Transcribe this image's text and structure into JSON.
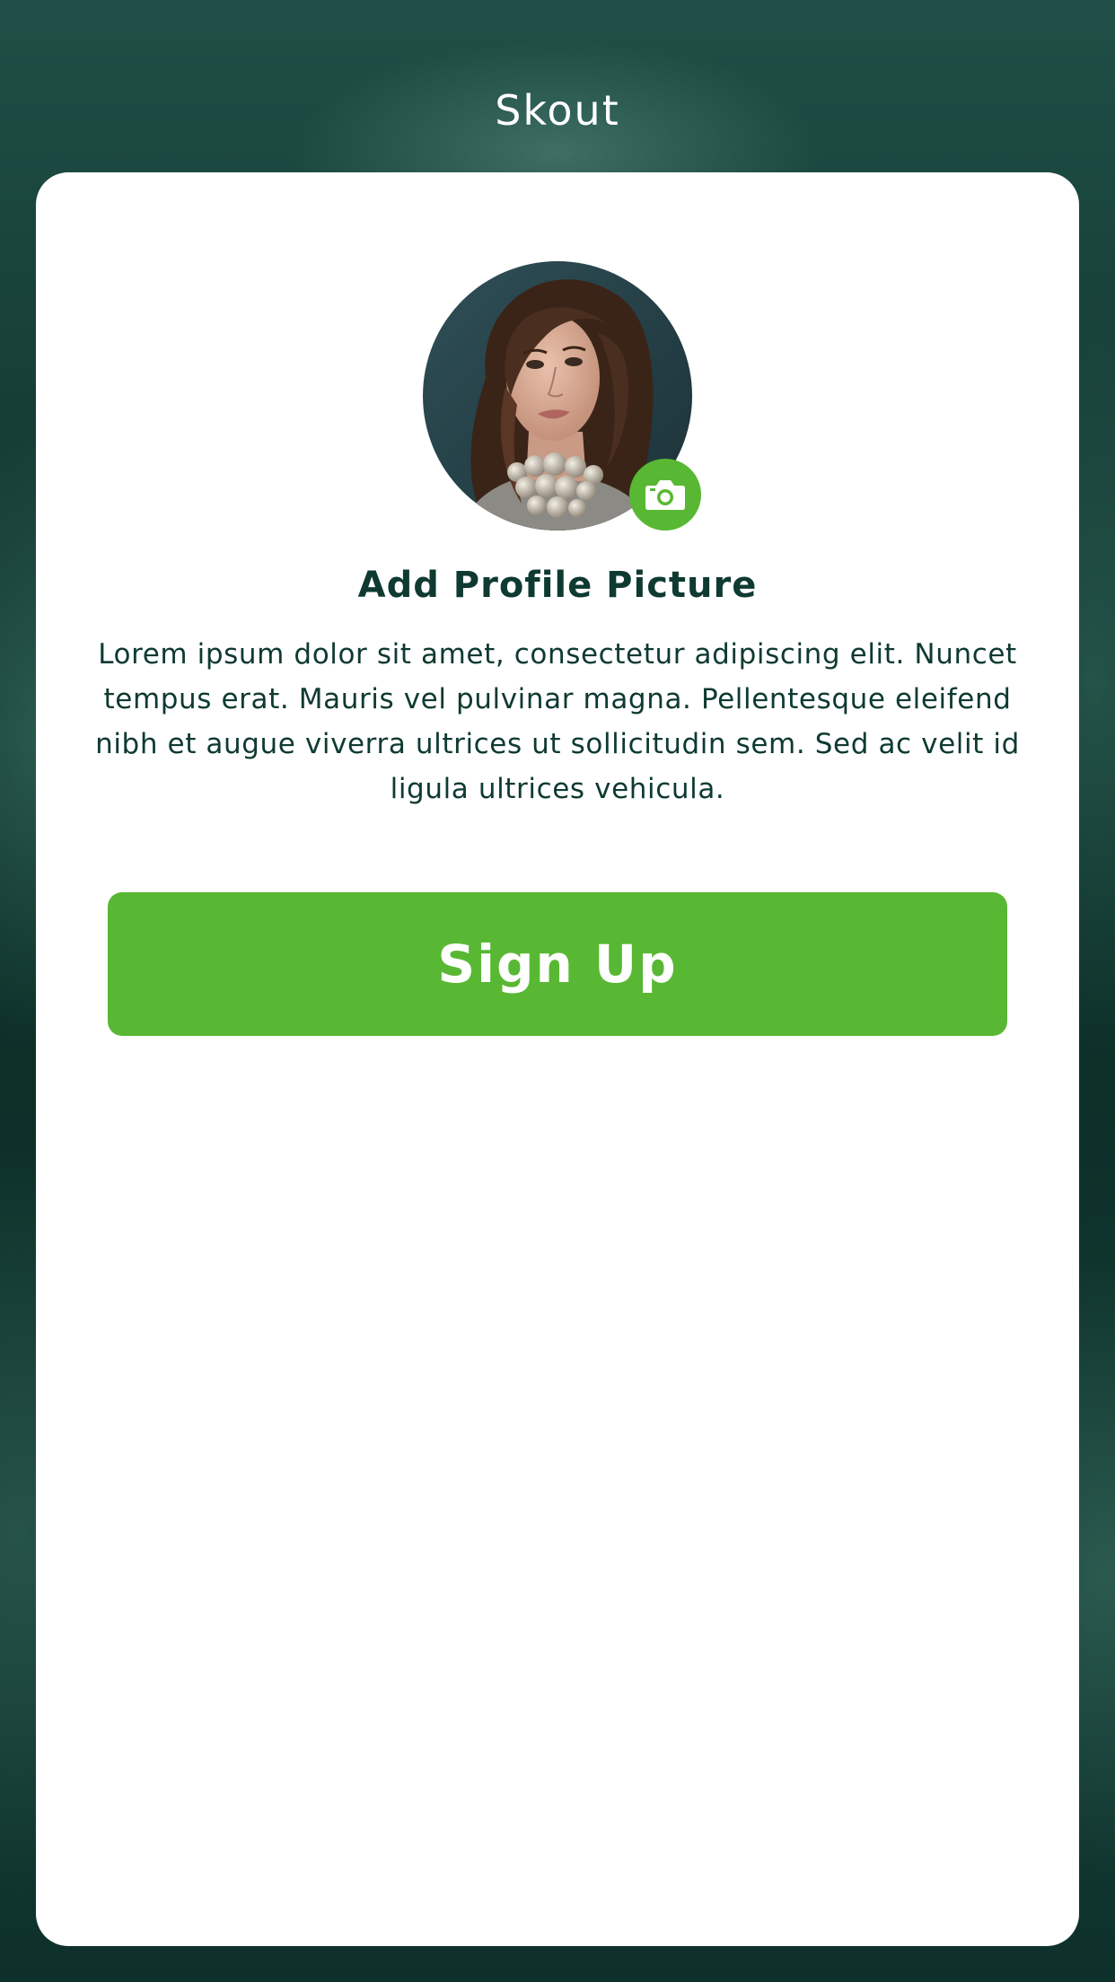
{
  "app": {
    "title": "Skout"
  },
  "profile": {
    "title": "Add Profile Picture",
    "description": "Lorem ipsum dolor sit amet, consectetur adipiscing elit. Nuncet tempus erat. Mauris vel pulvinar magna. Pellentesque eleifend nibh et augue viverra ultrices ut sollicitudin sem. Sed ac velit id ligula ultrices vehicula.",
    "avatar_icon": "user-photo",
    "badge_icon": "camera-icon"
  },
  "actions": {
    "signup_label": "Sign Up"
  },
  "colors": {
    "accent": "#58b833",
    "text_dark": "#0e3a31",
    "background": "#11362f",
    "card": "#ffffff"
  }
}
